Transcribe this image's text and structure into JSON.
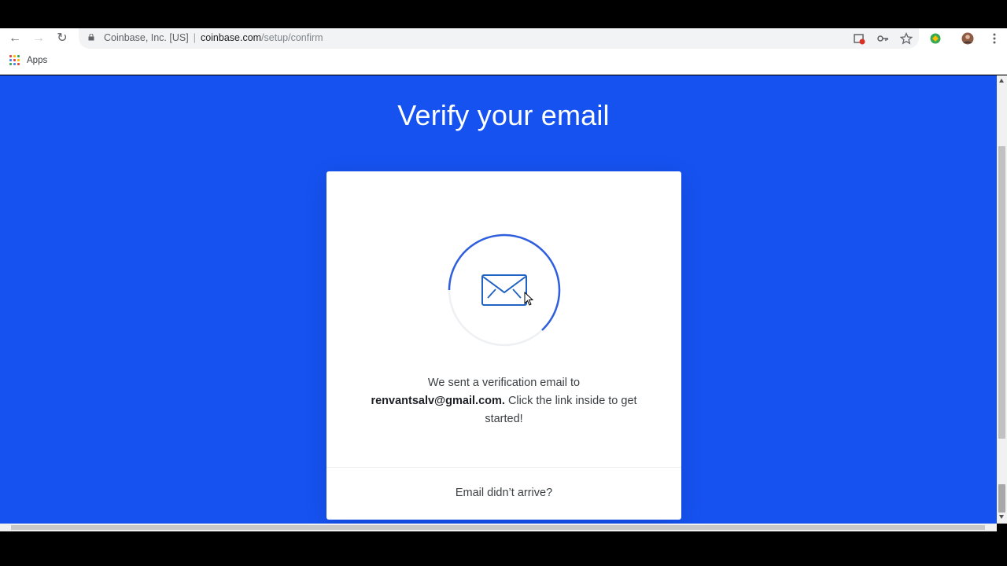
{
  "browser": {
    "site_identity": "Coinbase, Inc. [US]",
    "url_host": "coinbase.com",
    "url_path": "/setup/confirm",
    "bookmarks": [
      {
        "label": "Apps"
      }
    ]
  },
  "page": {
    "title": "Verify your email",
    "message_prefix": "We sent a verification email to",
    "email": "renvantsalv@gmail.com.",
    "message_suffix": "Click the link inside to get started!",
    "resend_link": "Email didn’t arrive?"
  },
  "colors": {
    "page_background": "#1652f0",
    "accent": "#1652f0",
    "card": "#ffffff"
  }
}
